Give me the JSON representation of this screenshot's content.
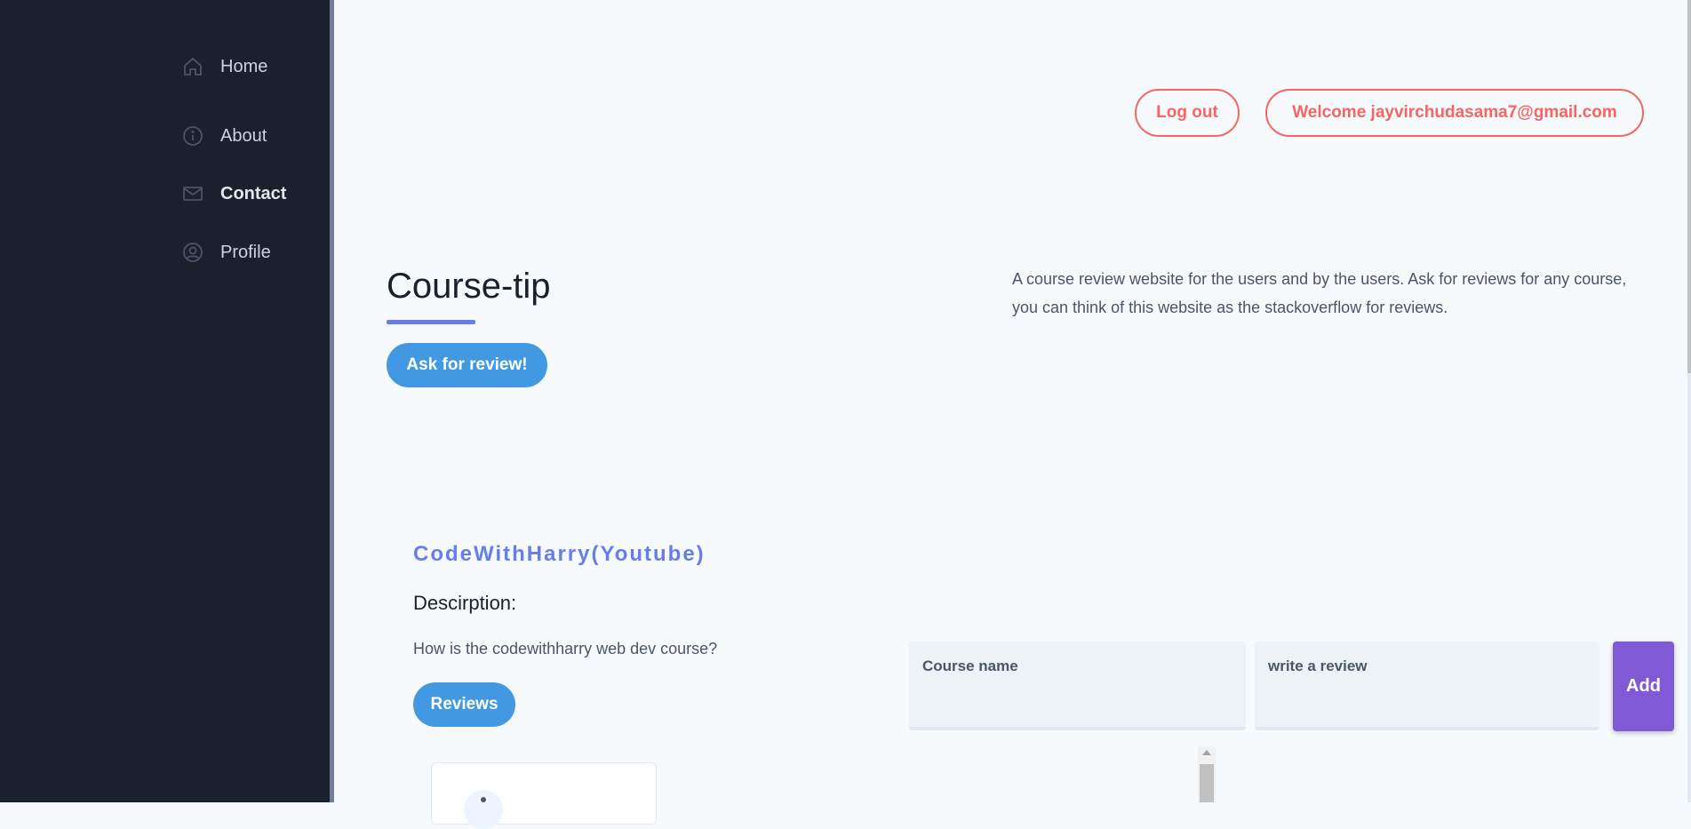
{
  "sidebar": {
    "items": [
      {
        "label": "Home",
        "icon": "home-icon"
      },
      {
        "label": "About",
        "icon": "info-icon"
      },
      {
        "label": "Contact",
        "icon": "mail-icon",
        "active": true
      },
      {
        "label": "Profile",
        "icon": "user-circle-icon"
      }
    ]
  },
  "header": {
    "logout_label": "Log out",
    "welcome_label": "Welcome jayvirchudasama7@gmail.com"
  },
  "hero": {
    "title": "Course-tip",
    "ask_button": "Ask for review!",
    "intro": "A course review website for the users and by the users. Ask for reviews for any course, you can think of this website as the stackoverflow for reviews."
  },
  "course": {
    "name": "CodeWithHarry(Youtube)",
    "description_heading": "Descirption:",
    "description": "How is the codewithharry web dev course?",
    "reviews_button": "Reviews"
  },
  "review_form": {
    "course_name_label": "Course name",
    "review_label": "write a review",
    "add_button": "Add"
  },
  "colors": {
    "sidebar_bg": "#1a202c",
    "accent_red": "#f56565",
    "accent_blue": "#4299e1",
    "accent_indigo": "#667eea",
    "accent_purple": "#805ad5"
  }
}
